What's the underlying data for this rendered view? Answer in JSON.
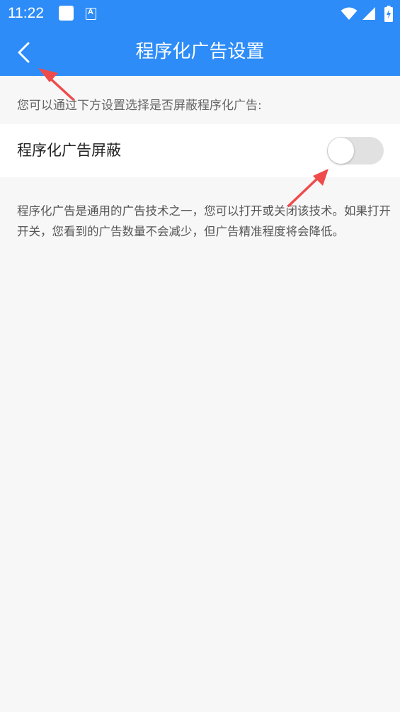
{
  "status_bar": {
    "time": "11:22",
    "icons": [
      "notification-square-icon",
      "a-app-icon",
      "wifi-icon",
      "signal-icon",
      "battery-charging-icon"
    ]
  },
  "app_bar": {
    "title": "程序化广告设置",
    "back_icon": "chevron-left-icon"
  },
  "content": {
    "hint": "您可以通过下方设置选择是否屏蔽程序化广告:",
    "setting": {
      "label": "程序化广告屏蔽",
      "enabled": false
    },
    "description": "程序化广告是通用的广告技术之一，您可以打开或关闭该技术。如果打开开关，您看到的广告数量不会减少，但广告精准程度将会降低。"
  },
  "colors": {
    "primary": "#2d8cf7",
    "background": "#f7f7f8",
    "annotation_arrow": "#ef4b4b",
    "toggle_off": "#e1e1e1"
  }
}
